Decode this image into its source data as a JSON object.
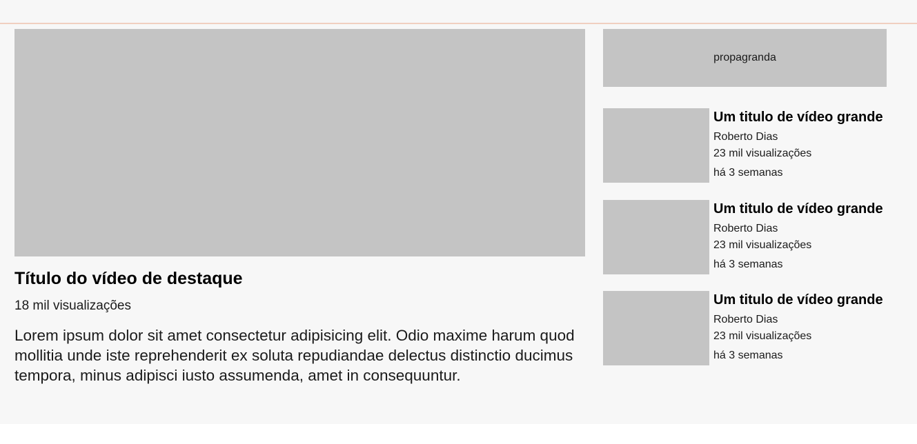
{
  "featured": {
    "title": "Título do vídeo de destaque",
    "views": "18 mil visualizações",
    "description": "Lorem ipsum dolor sit amet consectetur adipisicing elit. Odio maxime harum quod mollitia unde iste reprehenderit ex soluta repudiandae delectus distinctio ducimus tempora, minus adipisci iusto assumenda, amet in consequuntur."
  },
  "ad": {
    "label": "propagranda"
  },
  "videos": [
    {
      "title": "Um titulo de vídeo grande",
      "channel": "Roberto Dias",
      "views": "23  mil visualizações",
      "age": "há 3 semanas"
    },
    {
      "title": "Um titulo de vídeo grande",
      "channel": "Roberto Dias",
      "views": "23  mil visualizações",
      "age": "há 3 semanas"
    },
    {
      "title": "Um titulo de vídeo grande",
      "channel": "Roberto Dias",
      "views": "23  mil visualizações",
      "age": "há 3 semanas"
    }
  ]
}
